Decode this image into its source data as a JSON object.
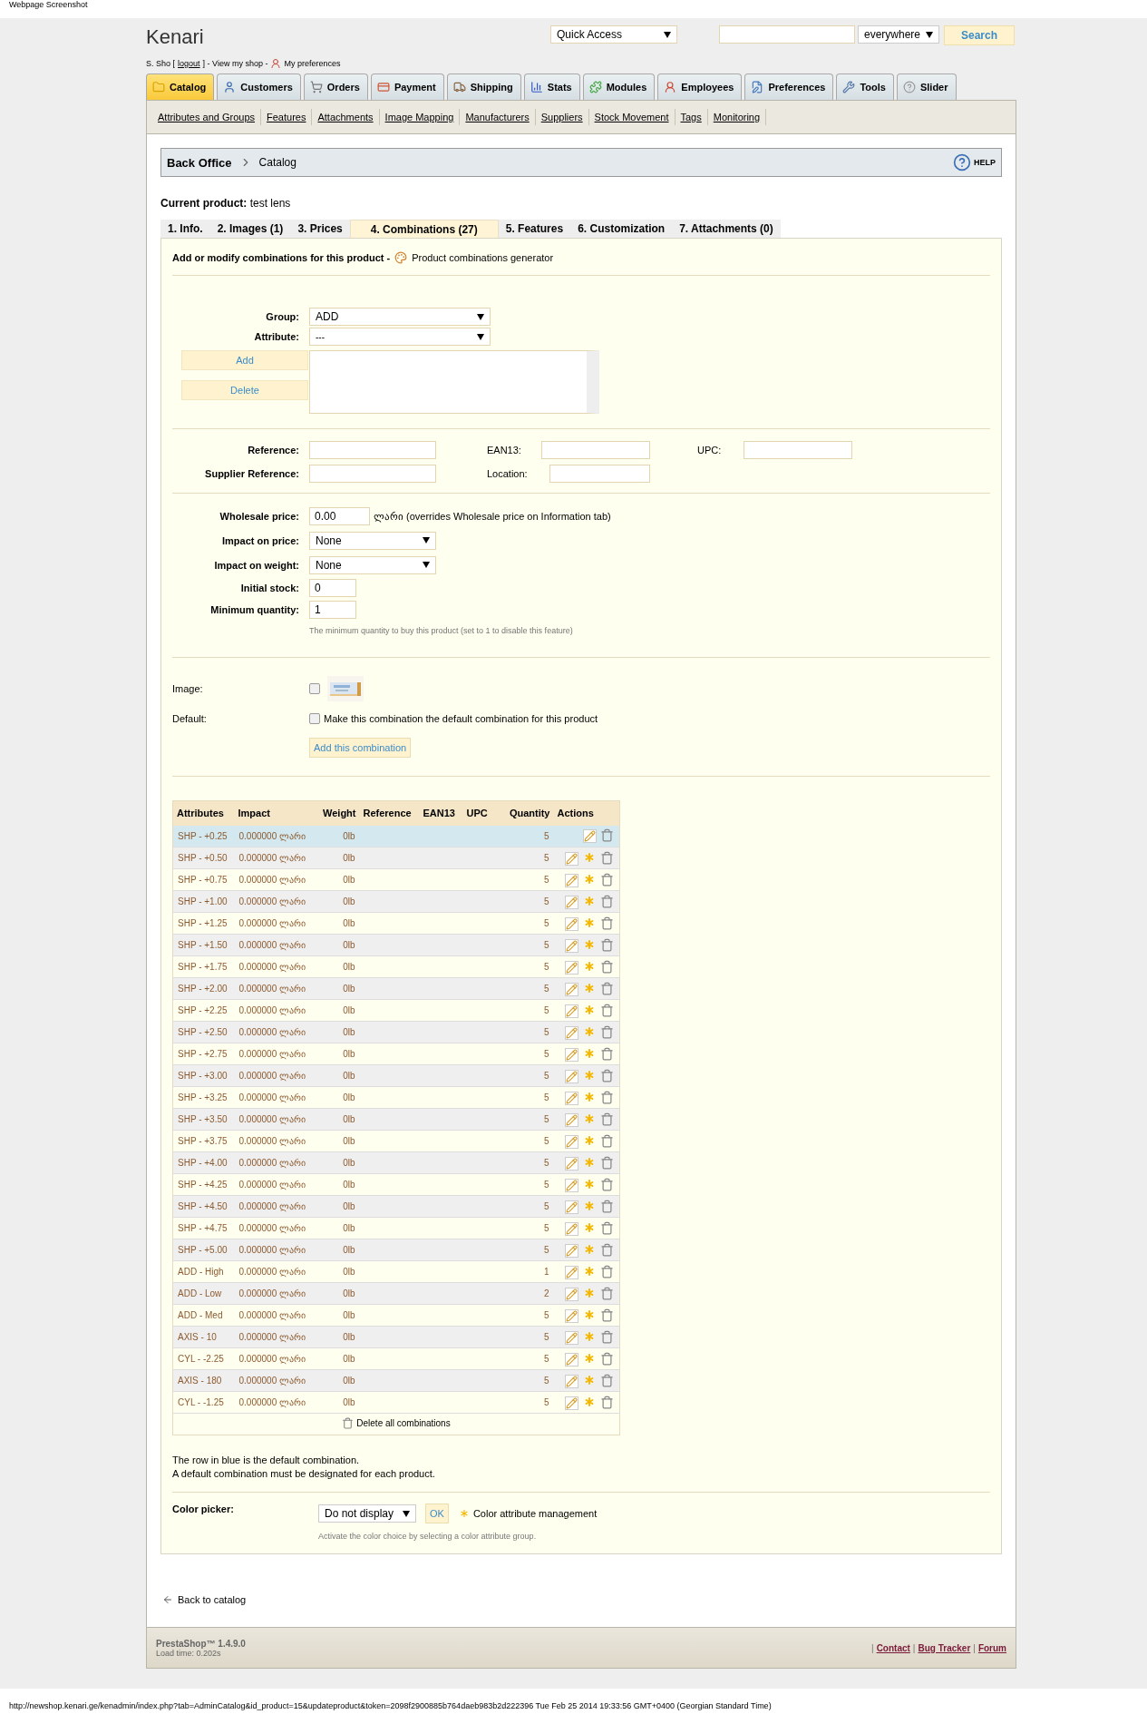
{
  "caption": "Webpage Screenshot",
  "header": {
    "shop_name": "Kenari",
    "quick_access": "Quick Access",
    "search": {
      "scope": "everywhere",
      "button": "Search"
    },
    "user_line": {
      "name": "S. Sho [",
      "logout": "logout",
      "middle": "] - View my shop -",
      "preferences": "My preferences"
    }
  },
  "main_tabs": [
    {
      "label": "Catalog",
      "selected": true
    },
    {
      "label": "Customers",
      "selected": false
    },
    {
      "label": "Orders",
      "selected": false
    },
    {
      "label": "Payment",
      "selected": false
    },
    {
      "label": "Shipping",
      "selected": false
    },
    {
      "label": "Stats",
      "selected": false
    },
    {
      "label": "Modules",
      "selected": false
    },
    {
      "label": "Employees",
      "selected": false
    },
    {
      "label": "Preferences",
      "selected": false
    },
    {
      "label": "Tools",
      "selected": false
    },
    {
      "label": "Slider",
      "selected": false
    }
  ],
  "sub_nav": [
    "Attributes and Groups",
    "Features",
    "Attachments",
    "Image Mapping",
    "Manufacturers",
    "Suppliers",
    "Stock Movement",
    "Tags",
    "Monitoring"
  ],
  "breadcrumb": {
    "root": "Back Office",
    "current": "Catalog",
    "help": "HELP"
  },
  "current_product": "**Current product:** test lens",
  "product_tabs": [
    {
      "label": "1. Info.",
      "selected": false
    },
    {
      "label": "2. Images (1)",
      "selected": false
    },
    {
      "label": "3. Prices",
      "selected": false
    },
    {
      "label": "4. Combinations (27)",
      "selected": true
    },
    {
      "label": "5. Features",
      "selected": false
    },
    {
      "label": "6. Customization",
      "selected": false
    },
    {
      "label": "7. Attachments (0)",
      "selected": false
    }
  ],
  "intro": {
    "text": "Add or modify combinations for this product -",
    "link": "Product combinations generator"
  },
  "attribute_picker": {
    "group_label": "Group:",
    "group_value": "ADD",
    "attribute_label": "Attribute:",
    "attribute_value": "---",
    "add_button": "Add",
    "delete_button": "Delete"
  },
  "references": {
    "reference_label": "Reference:",
    "ean13_label": "EAN13:",
    "upc_label": "UPC:",
    "supplier_reference_label": "Supplier Reference:",
    "location_label": "Location:"
  },
  "pricing": {
    "wholesale_label": "Wholesale price:",
    "wholesale_value": "0.00",
    "wholesale_note": "ლარი (overrides Wholesale price on Information tab)",
    "impact_price_label": "Impact on price:",
    "impact_price_value": "None",
    "impact_weight_label": "Impact on weight:",
    "impact_weight_value": "None",
    "initial_stock_label": "Initial stock:",
    "initial_stock_value": "0",
    "min_qty_label": "Minimum quantity:",
    "min_qty_value": "1",
    "hint": "The minimum quantity to buy this product (set to 1 to disable this feature)"
  },
  "image_choice": {
    "label": "Image:",
    "checked": false
  },
  "default_choice": {
    "label": "Default:",
    "text": "Make this combination the default combination for this product",
    "checked": false
  },
  "add_combination_button": "Add this combination",
  "table": {
    "columns": [
      "Attributes",
      "Impact",
      "Weight",
      "Reference",
      "EAN13",
      "UPC",
      "Quantity",
      "Actions"
    ],
    "rows": [
      {
        "attributes": "SHP - +0.25",
        "impact": "0.000000 ლარი",
        "weight": "0lb",
        "quantity": "5",
        "default": true
      },
      {
        "attributes": "SHP - +0.50",
        "impact": "0.000000 ლარი",
        "weight": "0lb",
        "quantity": "5",
        "default": false
      },
      {
        "attributes": "SHP - +0.75",
        "impact": "0.000000 ლარი",
        "weight": "0lb",
        "quantity": "5",
        "default": false
      },
      {
        "attributes": "SHP - +1.00",
        "impact": "0.000000 ლარი",
        "weight": "0lb",
        "quantity": "5",
        "default": false
      },
      {
        "attributes": "SHP - +1.25",
        "impact": "0.000000 ლარი",
        "weight": "0lb",
        "quantity": "5",
        "default": false
      },
      {
        "attributes": "SHP - +1.50",
        "impact": "0.000000 ლარი",
        "weight": "0lb",
        "quantity": "5",
        "default": false
      },
      {
        "attributes": "SHP - +1.75",
        "impact": "0.000000 ლარი",
        "weight": "0lb",
        "quantity": "5",
        "default": false
      },
      {
        "attributes": "SHP - +2.00",
        "impact": "0.000000 ლარი",
        "weight": "0lb",
        "quantity": "5",
        "default": false
      },
      {
        "attributes": "SHP - +2.25",
        "impact": "0.000000 ლარი",
        "weight": "0lb",
        "quantity": "5",
        "default": false
      },
      {
        "attributes": "SHP - +2.50",
        "impact": "0.000000 ლარი",
        "weight": "0lb",
        "quantity": "5",
        "default": false
      },
      {
        "attributes": "SHP - +2.75",
        "impact": "0.000000 ლარი",
        "weight": "0lb",
        "quantity": "5",
        "default": false
      },
      {
        "attributes": "SHP - +3.00",
        "impact": "0.000000 ლარი",
        "weight": "0lb",
        "quantity": "5",
        "default": false
      },
      {
        "attributes": "SHP - +3.25",
        "impact": "0.000000 ლარი",
        "weight": "0lb",
        "quantity": "5",
        "default": false
      },
      {
        "attributes": "SHP - +3.50",
        "impact": "0.000000 ლარი",
        "weight": "0lb",
        "quantity": "5",
        "default": false
      },
      {
        "attributes": "SHP - +3.75",
        "impact": "0.000000 ლარი",
        "weight": "0lb",
        "quantity": "5",
        "default": false
      },
      {
        "attributes": "SHP - +4.00",
        "impact": "0.000000 ლარი",
        "weight": "0lb",
        "quantity": "5",
        "default": false
      },
      {
        "attributes": "SHP - +4.25",
        "impact": "0.000000 ლარი",
        "weight": "0lb",
        "quantity": "5",
        "default": false
      },
      {
        "attributes": "SHP - +4.50",
        "impact": "0.000000 ლარი",
        "weight": "0lb",
        "quantity": "5",
        "default": false
      },
      {
        "attributes": "SHP - +4.75",
        "impact": "0.000000 ლარი",
        "weight": "0lb",
        "quantity": "5",
        "default": false
      },
      {
        "attributes": "SHP - +5.00",
        "impact": "0.000000 ლარი",
        "weight": "0lb",
        "quantity": "5",
        "default": false
      },
      {
        "attributes": "ADD - High",
        "impact": "0.000000 ლარი",
        "weight": "0lb",
        "quantity": "1",
        "default": false
      },
      {
        "attributes": "ADD - Low",
        "impact": "0.000000 ლარი",
        "weight": "0lb",
        "quantity": "2",
        "default": false
      },
      {
        "attributes": "ADD - Med",
        "impact": "0.000000 ლარი",
        "weight": "0lb",
        "quantity": "5",
        "default": false
      },
      {
        "attributes": "AXIS - 10",
        "impact": "0.000000 ლარი",
        "weight": "0lb",
        "quantity": "5",
        "default": false
      },
      {
        "attributes": "CYL - -2.25",
        "impact": "0.000000 ლარი",
        "weight": "0lb",
        "quantity": "5",
        "default": false
      },
      {
        "attributes": "AXIS - 180",
        "impact": "0.000000 ლარი",
        "weight": "0lb",
        "quantity": "5",
        "default": false
      },
      {
        "attributes": "CYL - -1.25",
        "impact": "0.000000 ლარი",
        "weight": "0lb",
        "quantity": "5",
        "default": false
      }
    ],
    "delete_all": "Delete all combinations"
  },
  "notes": [
    "The row in blue is the default combination.",
    "A default combination must be designated for each product."
  ],
  "color_picker": {
    "label": "Color picker:",
    "value": "Do not display",
    "ok_button": "OK",
    "link": "Color attribute management",
    "hint": "Activate the color choice by selecting a color attribute group."
  },
  "back_link": "Back to catalog",
  "footer": {
    "version": "PrestaShop™ 1.4.9.0",
    "load_time": "Load time: 0.202s",
    "separator": "|",
    "links": [
      "Contact",
      "Bug Tracker",
      "Forum"
    ]
  },
  "status_bar": "http://newshop.kenari.ge/kenadmin/index.php?tab=AdminCatalog&id_product=15&updateproduct&token=2098f2900885b764daeb983b2d222396 Tue Feb 25 2014 19:33:56 GMT+0400 (Georgian Standard Time)"
}
